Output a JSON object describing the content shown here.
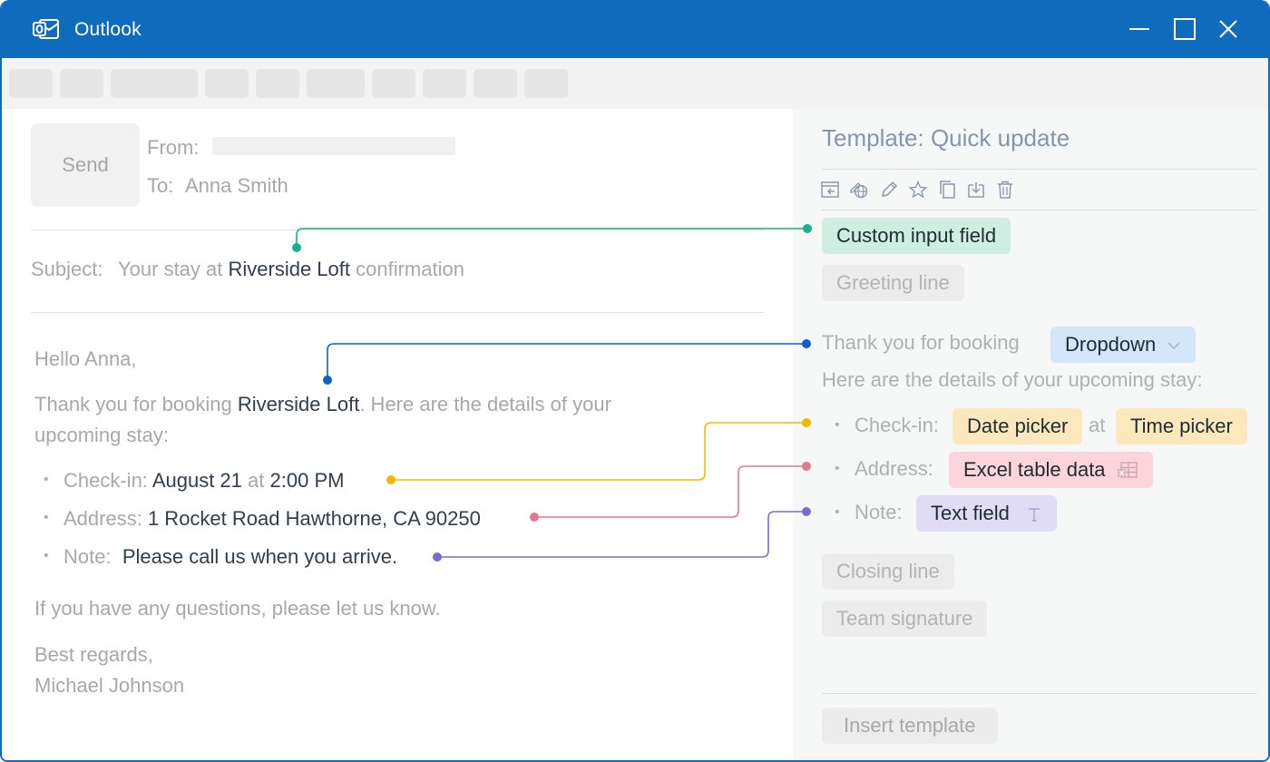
{
  "app": {
    "title": "Outlook"
  },
  "compose": {
    "send_label": "Send",
    "from_label": "From:",
    "to_label": "To:",
    "to_value": "Anna Smith",
    "subject_label": "Subject:",
    "subject_prefix": "Your stay at ",
    "subject_highlight": "Riverside Loft",
    "subject_suffix": " confirmation",
    "greeting": "Hello Anna,",
    "thanks_prefix": "Thank you for booking ",
    "thanks_highlight": "Riverside Loft",
    "thanks_suffix": ". Here are the details of your",
    "thanks_line2": "upcoming stay:",
    "checkin_label": "Check-in:",
    "checkin_date": "August 21",
    "checkin_at": "at",
    "checkin_time": "2:00 PM",
    "address_label": "Address:",
    "address_value": "1 Rocket Road Hawthorne, CA 90250",
    "note_label": "Note:",
    "note_value": "Please call us when you arrive.",
    "questions": "If you have any questions, please let us know.",
    "closing": "Best regards,",
    "signature": "Michael Johnson"
  },
  "template": {
    "title": "Template: Quick update",
    "toolbar_icons": [
      "insert-icon",
      "globe-edit-icon",
      "pencil-icon",
      "star-icon",
      "copy-icon",
      "download-icon",
      "trash-icon"
    ],
    "custom_input": "Custom input field",
    "greeting_line": "Greeting line",
    "thanks_text": "Thank you for booking",
    "dropdown": "Dropdown",
    "details_text": "Here are the details of your upcoming stay:",
    "checkin_label": "Check-in:",
    "date_picker": "Date picker",
    "at_text": "at",
    "time_picker": "Time picker",
    "address_label": "Address:",
    "excel_data": "Excel table data",
    "note_label": "Note:",
    "text_field": "Text field",
    "closing_line": "Closing line",
    "team_signature": "Team signature",
    "insert_button": "Insert template"
  },
  "colors": {
    "brand": "#0f6cbd",
    "green": "#12b28c",
    "blue": "#0f5fc4",
    "yellow": "#f5b800",
    "pink": "#e0798d",
    "purple": "#7b6bd1"
  }
}
